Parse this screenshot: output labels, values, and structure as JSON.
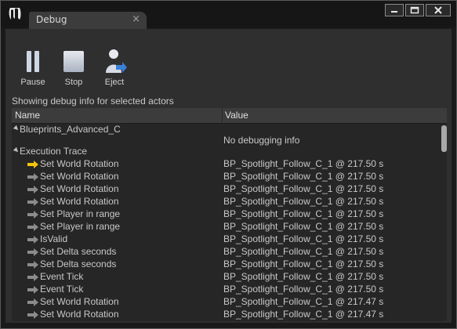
{
  "window": {
    "tab_title": "Debug",
    "tab_close": "×"
  },
  "toolbar": {
    "pause_label": "Pause",
    "stop_label": "Stop",
    "eject_label": "Eject"
  },
  "status_text": "Showing debug info for selected actors",
  "table": {
    "columns": [
      "Name",
      "Value"
    ],
    "blueprint": {
      "name": "Blueprints_Advanced_C",
      "value": "No debugging info"
    },
    "trace_header": "Execution Trace",
    "rows": [
      {
        "name": "Set World Rotation",
        "value": "BP_Spotlight_Follow_C_1 @ 217.50 s",
        "current": true
      },
      {
        "name": "Set World Rotation",
        "value": "BP_Spotlight_Follow_C_1 @ 217.50 s",
        "current": false
      },
      {
        "name": "Set World Rotation",
        "value": "BP_Spotlight_Follow_C_1 @ 217.50 s",
        "current": false
      },
      {
        "name": "Set World Rotation",
        "value": "BP_Spotlight_Follow_C_1 @ 217.50 s",
        "current": false
      },
      {
        "name": "Set Player in range",
        "value": "BP_Spotlight_Follow_C_1 @ 217.50 s",
        "current": false
      },
      {
        "name": "Set Player in range",
        "value": "BP_Spotlight_Follow_C_1 @ 217.50 s",
        "current": false
      },
      {
        "name": "IsValid",
        "value": "BP_Spotlight_Follow_C_1 @ 217.50 s",
        "current": false
      },
      {
        "name": "Set Delta seconds",
        "value": "BP_Spotlight_Follow_C_1 @ 217.50 s",
        "current": false
      },
      {
        "name": "Set Delta seconds",
        "value": "BP_Spotlight_Follow_C_1 @ 217.50 s",
        "current": false
      },
      {
        "name": "Event Tick",
        "value": "BP_Spotlight_Follow_C_1 @ 217.50 s",
        "current": false
      },
      {
        "name": "Event Tick",
        "value": "BP_Spotlight_Follow_C_1 @ 217.50 s",
        "current": false
      },
      {
        "name": "Set World Rotation",
        "value": "BP_Spotlight_Follow_C_1 @ 217.47 s",
        "current": false
      },
      {
        "name": "Set World Rotation",
        "value": "BP_Spotlight_Follow_C_1 @ 217.47 s",
        "current": false
      }
    ]
  },
  "colors": {
    "current_arrow": "#f2c40e",
    "past_arrow": "#8c8c8c",
    "panel": "#2f2f2f"
  }
}
